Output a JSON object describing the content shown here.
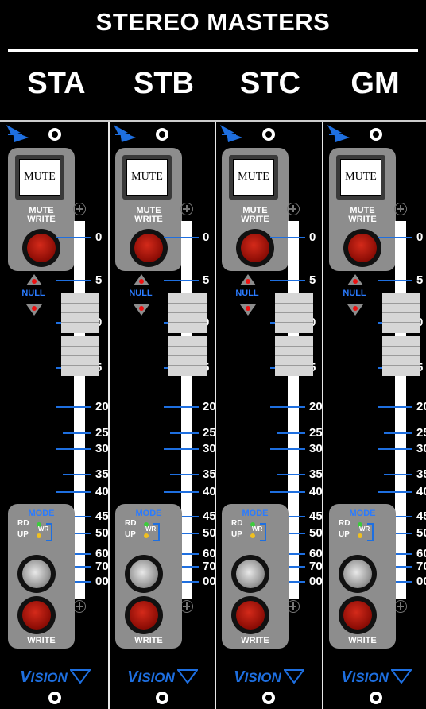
{
  "header": {
    "title": "STEREO MASTERS",
    "channels": [
      "STA",
      "STB",
      "STC",
      "GM"
    ]
  },
  "strip": {
    "mute_label": "MUTE",
    "mute_write_line1": "MUTE",
    "mute_write_line2": "WRITE",
    "null_label": "NULL",
    "mode_label": "MODE",
    "rd_label": "RD",
    "wr_label": "WR",
    "up_label": "UP",
    "write_label": "WRITE",
    "brand_first": "V",
    "brand_rest": "ISION",
    "scale": [
      "0",
      "5",
      "0",
      "5",
      "20",
      "25",
      "30",
      "35",
      "40",
      "45",
      "50",
      "60",
      "70",
      "00"
    ]
  },
  "colors": {
    "accent": "#1e6fe0",
    "panel": "#8d8d8d",
    "led_green": "#3ccc3c",
    "led_yellow": "#f0c020",
    "button_red": "#8a0c05"
  }
}
